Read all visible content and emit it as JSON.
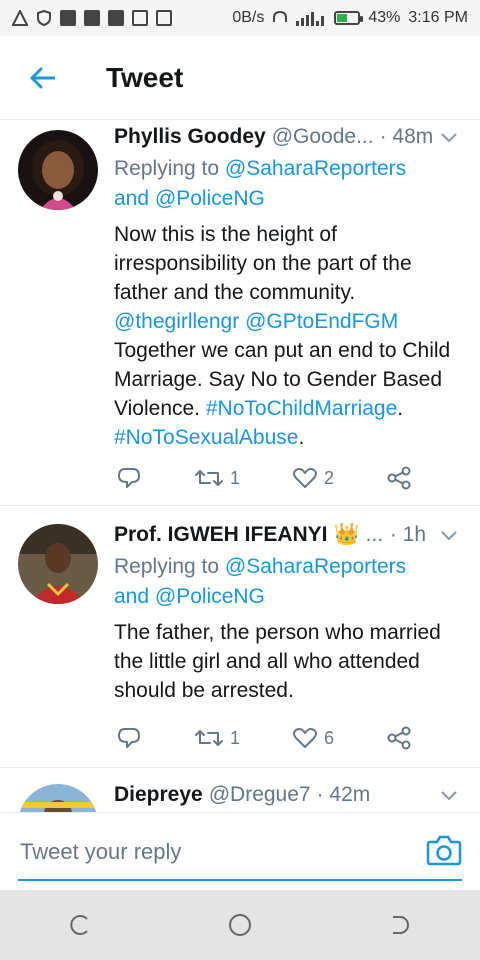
{
  "status_bar": {
    "net_speed": "0B/s",
    "battery_pct": "43%",
    "time": "3:16 PM"
  },
  "header": {
    "title": "Tweet",
    "back_icon": "arrow-left-icon"
  },
  "tweets": [
    {
      "name": "Phyllis Goodey",
      "handle": "@Goode...",
      "time": "· 48m",
      "replying_prefix": "Replying to ",
      "reply_mention_1": "@SaharaReporters",
      "reply_and": "and ",
      "reply_mention_2": "@PoliceNG",
      "text_1": "Now this is the height of irresponsibility on the part of the father and the community.",
      "link_1": "@thegirllengr",
      "link_2": "@GPtoEndFGM",
      "text_2": "Together we can put an end to Child Marriage. Say No to Gender Based Violence.",
      "link_3": "#NoToChildMarriage",
      "dot_1": ".",
      "link_4": "#NoToSexualAbuse",
      "dot_2": ".",
      "retweets": "1",
      "likes": "2"
    },
    {
      "name": "Prof. IGWEH IFEANYI",
      "crown": "👑",
      "handle": "...",
      "time": "· 1h",
      "replying_prefix": "Replying to ",
      "reply_mention_1": "@SaharaReporters",
      "reply_and": "and ",
      "reply_mention_2": "@PoliceNG",
      "text_1": "The father, the person who married the little girl and all who attended should be arrested.",
      "retweets": "1",
      "likes": "6"
    },
    {
      "name": "Diepreye",
      "handle": "@Dregue7",
      "time": "· 42m"
    }
  ],
  "reply_box": {
    "placeholder": "Tweet your reply"
  },
  "colors": {
    "accent": "#1b95e0",
    "secondary_text": "#657786",
    "divider": "#e6ecf0"
  }
}
